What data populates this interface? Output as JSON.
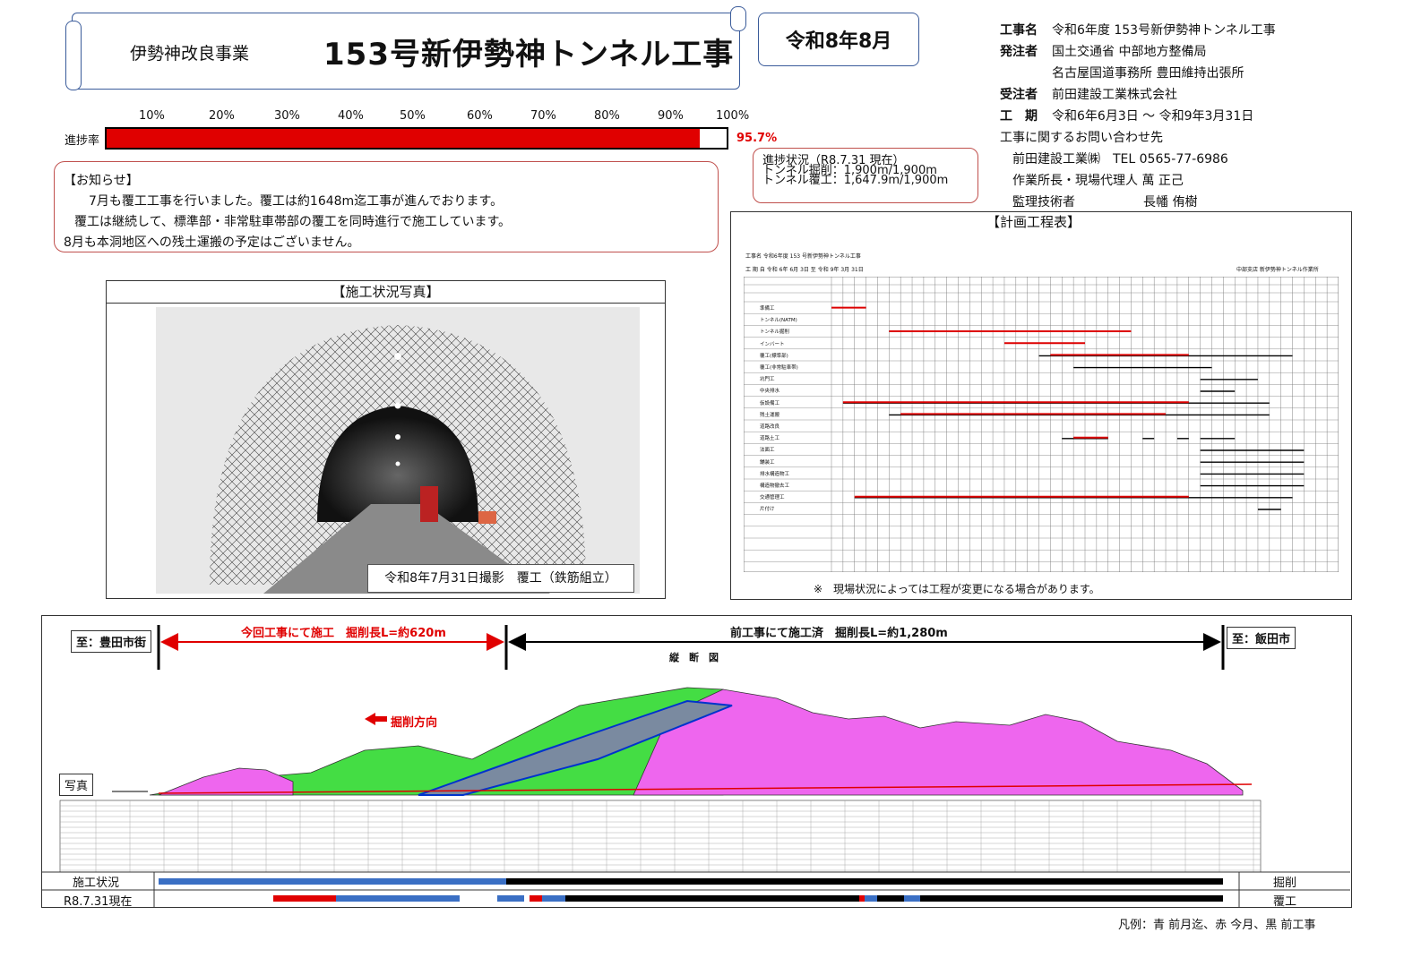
{
  "header": {
    "subtitle": "伊勢神改良事業",
    "title": "153号新伊勢神トンネル工事",
    "month": "令和8年8月"
  },
  "info": {
    "name_k": "工事名",
    "name_v": "令和6年度 153号新伊勢神トンネル工事",
    "client_k": "発注者",
    "client_v1": "国土交通省 中部地方整備局",
    "client_v2": "名古屋国道事務所 豊田維持出張所",
    "contractor_k": "受注者",
    "contractor_v": "前田建設工業株式会社",
    "period_k": "工　期",
    "period_v": "令和6年6月3日 〜 令和9年3月31日",
    "contact_title": "工事に関するお問い合わせ先",
    "contact_tel": "前田建設工業㈱　TEL 0565-77-6986",
    "contact_manager": "作業所長・現場代理人 萬 正己",
    "contact_engineer_k": "監理技術者",
    "contact_engineer_v": "長幡 侑樹"
  },
  "progress": {
    "label": "進捗率",
    "ticks": [
      "10%",
      "20%",
      "30%",
      "40%",
      "50%",
      "60%",
      "70%",
      "80%",
      "90%",
      "100%"
    ],
    "value": 95.7,
    "value_text": "95.7%",
    "color": "#e00000"
  },
  "notice": {
    "title": "【お知らせ】",
    "line1": "7月も覆工工事を行いました。覆工は約1648m迄工事が進んでおります。",
    "line2": "覆工は継続して、標準部・非常駐車帯部の覆工を同時進行で施工しています。",
    "line3": "8月も本洞地区への残土運搬の予定はございません。"
  },
  "status": {
    "line1": "進捗状況（R8.7.31 現在）",
    "line2": "トンネル掘削：1,900m/1,900m",
    "line3": "トンネル覆工：1,647.9m/1,900m"
  },
  "photo": {
    "header": "【施工状況写真】",
    "caption": "令和8年7月31日撮影　覆工（鉄筋組立）"
  },
  "schedule": {
    "header": "【計画工程表】",
    "doc_title": "工事名  令和6年度 153 号新伊勢神トンネル工事",
    "doc_period": "工  期  自   令和 6年 6月 3日    至    令和 9年 3月 31日",
    "doc_office": "中部支店  新伊勢神トンネル作業所",
    "note": "※　現場状況によっては工程が変更になる場合があります。",
    "rows": [
      "準備工",
      "トンネル(NATM)",
      "トンネル掘削",
      "インバート",
      "覆工(標準部)",
      "覆工(非常駐車帯)",
      "坑門工",
      "中央排水",
      "仮設備工",
      "残土運搬",
      "道路改良",
      "道路土工",
      "法面工",
      "舗装工",
      "排水構造物工",
      "構造物撤去工",
      "交通管理工",
      "片付け"
    ]
  },
  "profile": {
    "left_end": "至：豊田市街",
    "right_end": "至：飯田市",
    "current_work": "今回工事にて施工　掘削長L=約620m",
    "previous_work": "前工事にて施工済　掘削長L=約1,280m",
    "section_title": "縦　断　図",
    "direction": "掘削方向",
    "photo_tag": "写真",
    "status_label": "施工状況",
    "date_label": "R8.7.31現在",
    "excavation_label": "掘削",
    "lining_label": "覆工",
    "legend": "凡例：青 前月迄、赤 今月、黒 前工事"
  }
}
